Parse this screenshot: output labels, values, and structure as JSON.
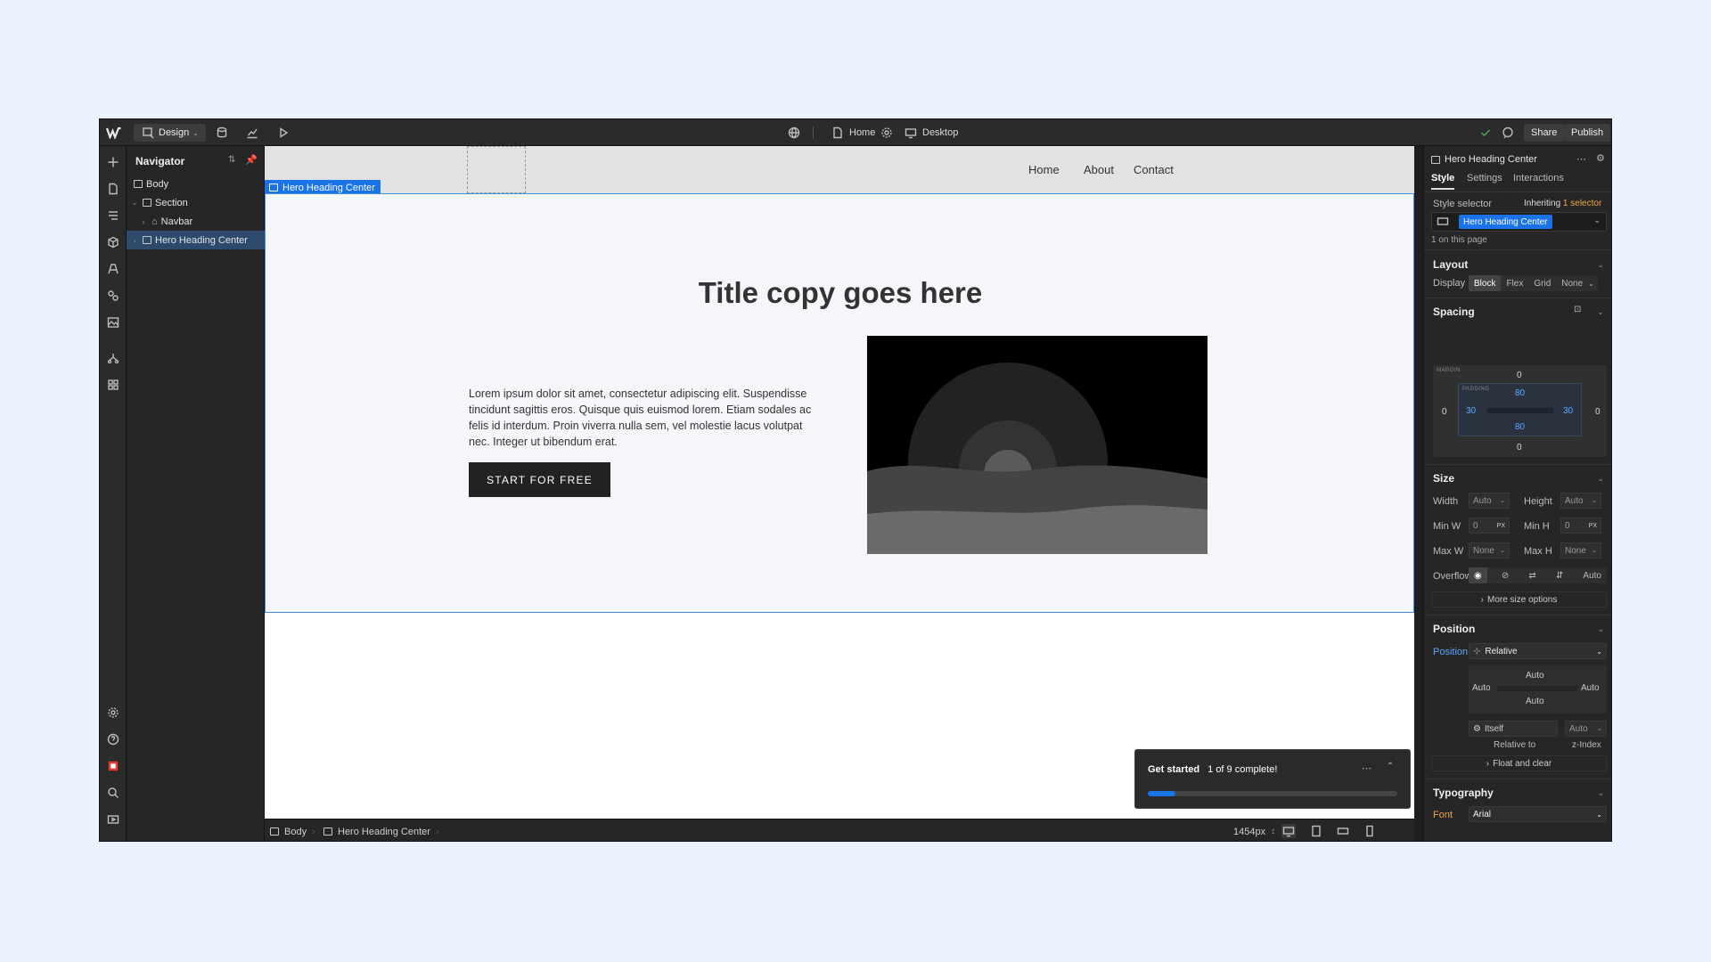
{
  "topbar": {
    "mode_label": "Design",
    "page_label": "Home",
    "breakpoint_label": "Desktop",
    "share_label": "Share",
    "publish_label": "Publish"
  },
  "navigator": {
    "title": "Navigator",
    "items": [
      {
        "label": "Body"
      },
      {
        "label": "Section"
      },
      {
        "label": "Navbar"
      },
      {
        "label": "Hero Heading Center"
      }
    ]
  },
  "canvas": {
    "nav_links": [
      "Home",
      "About",
      "Contact"
    ],
    "selected_tag": "Hero Heading Center",
    "hero_title": "Title copy goes here",
    "hero_body": "Lorem ipsum dolor sit amet, consectetur adipiscing elit. Suspendisse tincidunt sagittis eros. Quisque quis euismod lorem. Etiam sodales ac felis id interdum. Proin viverra nulla sem, vel molestie lacus volutpat nec. Integer ut bibendum erat.",
    "cta_label": "START FOR FREE"
  },
  "get_started": {
    "title": "Get started",
    "progress_text": "1 of 9 complete!",
    "progress_fraction": 0.111
  },
  "bottombar": {
    "crumbs": [
      "Body",
      "Hero Heading Center"
    ],
    "width_readout": "1454px"
  },
  "panel": {
    "element_name": "Hero Heading Center",
    "tabs": [
      "Style",
      "Settings",
      "Interactions"
    ],
    "style_selector_label": "Style selector",
    "inheriting_text": "Inheriting",
    "inheriting_count": "1 selector",
    "selector_chip": "Hero Heading Center",
    "on_page": "1 on this page",
    "layout": {
      "title": "Layout",
      "display_label": "Display",
      "display_options": [
        "Block",
        "Flex",
        "Grid",
        "None"
      ]
    },
    "spacing": {
      "title": "Spacing",
      "margin_label": "MARGIN",
      "padding_label": "PADDING",
      "margin": {
        "top": "0",
        "right": "0",
        "bottom": "0",
        "left": "0"
      },
      "padding": {
        "top": "80",
        "right": "30",
        "bottom": "80",
        "left": "30"
      }
    },
    "size": {
      "title": "Size",
      "width_label": "Width",
      "width_value": "Auto",
      "height_label": "Height",
      "height_value": "Auto",
      "minw_label": "Min W",
      "minw_value": "0",
      "minw_unit": "PX",
      "minh_label": "Min H",
      "minh_value": "0",
      "minh_unit": "PX",
      "maxw_label": "Max W",
      "maxw_value": "None",
      "maxh_label": "Max H",
      "maxh_value": "None",
      "overflow_label": "Overflow",
      "overflow_auto": "Auto",
      "more_label": "More size options"
    },
    "position": {
      "title": "Position",
      "position_label": "Position",
      "position_value": "Relative",
      "offset_top": "Auto",
      "offset_left": "Auto",
      "offset_right": "Auto",
      "offset_bottom": "Auto",
      "itself_label": "Itself",
      "z_value": "Auto",
      "relative_to_label": "Relative to",
      "z_index_label": "z-Index",
      "float_label": "Float and clear"
    },
    "typography": {
      "title": "Typography",
      "font_label": "Font",
      "font_value": "Arial"
    }
  },
  "colors": {
    "accent": "#1a73e8",
    "warning_label": "#f0a64a"
  }
}
